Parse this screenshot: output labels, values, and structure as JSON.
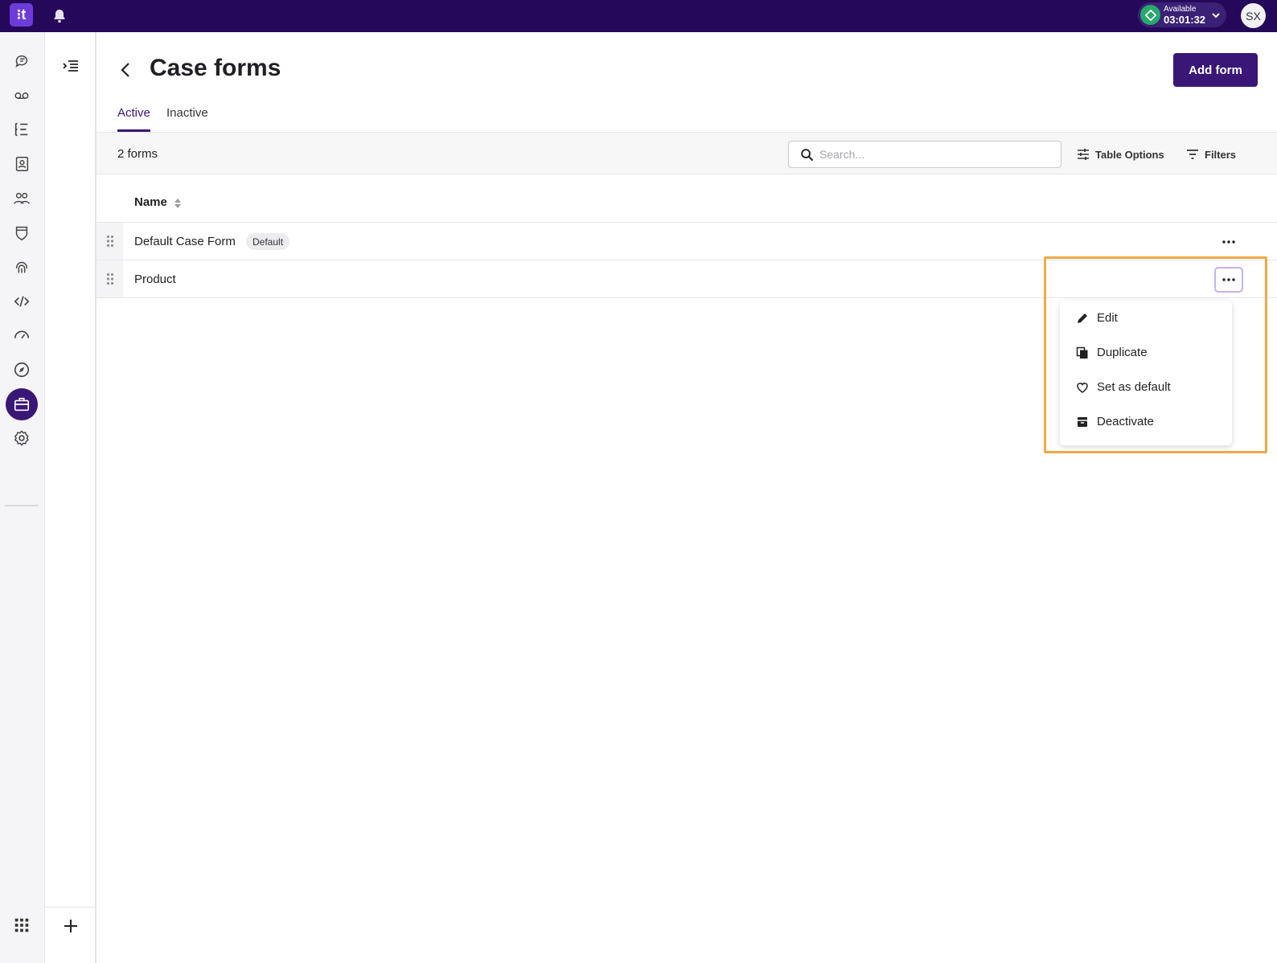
{
  "topbar": {
    "logo_text": "⁝t",
    "status_label": "Available",
    "status_time": "03:01:32",
    "avatar_initials": "SX",
    "colors": {
      "background": "#25085a",
      "status_ok": "#27a96b"
    }
  },
  "rail": {
    "icons": [
      "chat-icon",
      "voicemail-icon",
      "list-icon",
      "contacts-icon",
      "team-icon",
      "shield-icon",
      "fingerprint-icon",
      "code-icon",
      "gauge-icon",
      "compass-icon",
      "briefcase-icon",
      "gear-icon"
    ],
    "active": "briefcase-icon",
    "bottom_icon": "apps-grid-icon"
  },
  "page": {
    "title": "Case forms",
    "add_button": "Add form",
    "tabs": [
      {
        "label": "Active",
        "active": true
      },
      {
        "label": "Inactive",
        "active": false
      }
    ],
    "count_text": "2 forms",
    "search_placeholder": "Search...",
    "table_options": "Table Options",
    "filters": "Filters",
    "accent": "#3a1677"
  },
  "table": {
    "columns": [
      {
        "label": "Name",
        "sortable": true
      }
    ],
    "rows": [
      {
        "name": "Default Case Form",
        "badge": "Default"
      },
      {
        "name": "Product",
        "badge": ""
      }
    ]
  },
  "menu": {
    "items": [
      {
        "label": "Edit",
        "icon": "pencil-icon"
      },
      {
        "label": "Duplicate",
        "icon": "copy-icon"
      },
      {
        "label": "Set as default",
        "icon": "heart-icon"
      },
      {
        "label": "Deactivate",
        "icon": "archive-icon"
      }
    ]
  }
}
